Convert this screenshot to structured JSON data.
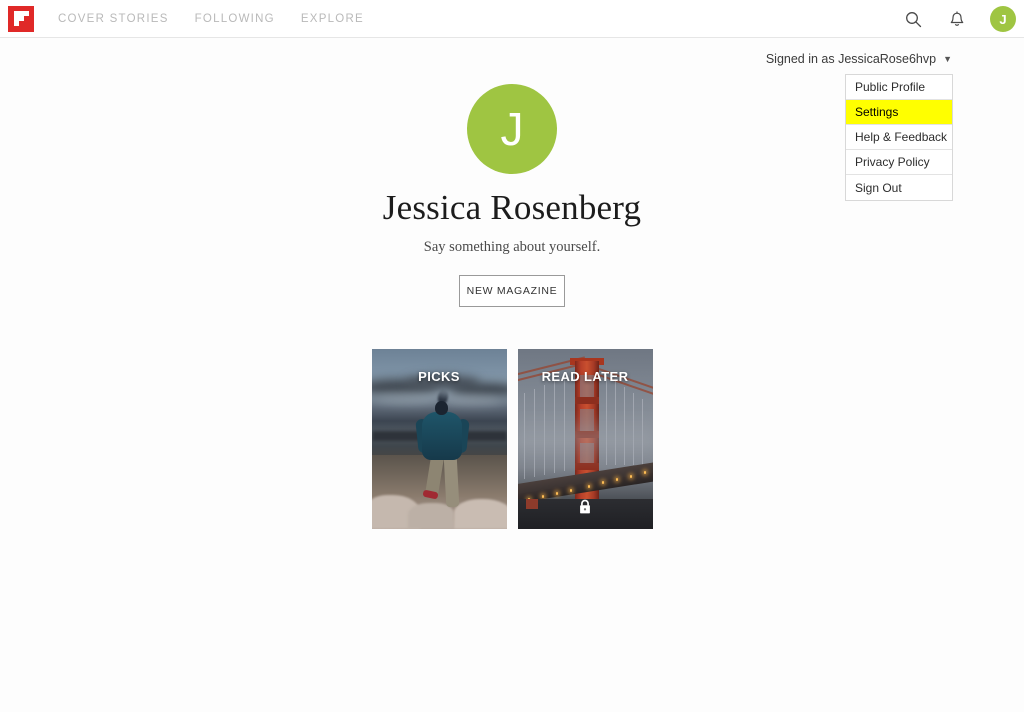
{
  "header": {
    "logo_icon": "flipboard-logo",
    "logo_color": "#e02928",
    "nav": [
      {
        "label": "COVER STORIES"
      },
      {
        "label": "FOLLOWING"
      },
      {
        "label": "EXPLORE"
      }
    ],
    "search_icon": "search-icon",
    "notifications_icon": "bell-icon",
    "avatar_initial": "J",
    "avatar_color": "#9fc542"
  },
  "account": {
    "signed_in_text": "Signed in as JessicaRose6hvp",
    "caret_icon": "chevron-down-icon",
    "menu": [
      {
        "label": "Public Profile",
        "highlighted": false
      },
      {
        "label": "Settings",
        "highlighted": true
      },
      {
        "label": "Help & Feedback",
        "highlighted": false
      },
      {
        "label": "Privacy Policy",
        "highlighted": false
      },
      {
        "label": "Sign Out",
        "highlighted": false
      }
    ],
    "highlight_color": "#ffff00"
  },
  "profile": {
    "avatar_initial": "J",
    "avatar_color": "#9fc542",
    "name": "Jessica Rosenberg",
    "description": "Say something about yourself.",
    "new_magazine_label": "NEW MAGAZINE"
  },
  "magazines": [
    {
      "title": "PICKS",
      "private": false,
      "cover_description": "Hiker in teal puffer jacket standing on a rocky cliff at dusk"
    },
    {
      "title": "READ LATER",
      "private": true,
      "lock_icon": "lock-icon",
      "cover_description": "Golden Gate Bridge tower in fog at dusk with amber roadway lights"
    }
  ]
}
